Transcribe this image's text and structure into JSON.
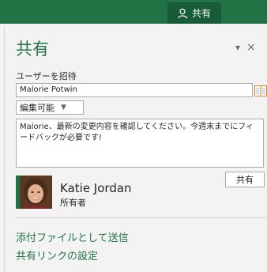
{
  "topbar": {
    "share_tab_label": "共有",
    "accent": "#217346"
  },
  "pane": {
    "title": "共有",
    "controls": {
      "menu_glyph": "▾",
      "close_glyph": "×"
    }
  },
  "invite": {
    "label": "ユーザーを招待",
    "name_value": "Malorie Potwin",
    "permission": "編集可能",
    "message": "Malorie、最新の変更内容を確認してください。今週末までにフィードバックが必要です!",
    "share_button_label": "共有"
  },
  "owner": {
    "name": "Katie Jordan",
    "role": "所有者"
  },
  "links": {
    "attach": "添付ファイルとして送信",
    "settings": "共有リンクの設定"
  }
}
